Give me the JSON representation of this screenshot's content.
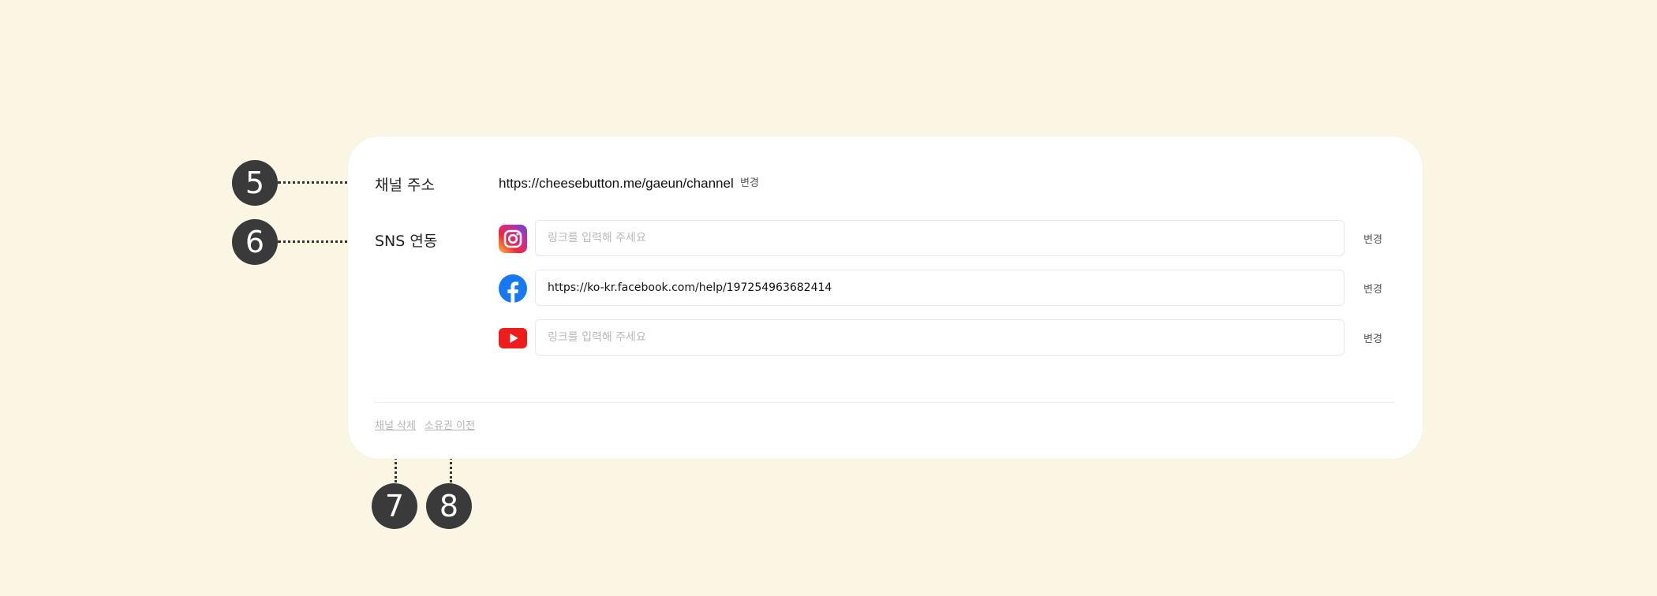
{
  "channel_address": {
    "label": "채널 주소",
    "url": "https://cheesebutton.me/gaeun/channel",
    "change_label": "변경"
  },
  "sns": {
    "label": "SNS 연동",
    "rows": [
      {
        "icon": "instagram-icon",
        "value": "",
        "placeholder": "링크를 입력해 주세요",
        "change_label": "변경"
      },
      {
        "icon": "facebook-icon",
        "value": "https://ko-kr.facebook.com/help/197254963682414",
        "placeholder": "링크를 입력해 주세요",
        "change_label": "변경"
      },
      {
        "icon": "youtube-icon",
        "value": "",
        "placeholder": "링크를 입력해 주세요",
        "change_label": "변경"
      }
    ]
  },
  "footer": {
    "delete_channel": "채널 삭제",
    "transfer_ownership": "소유권 이전"
  },
  "markers": [
    "5",
    "6",
    "7",
    "8"
  ],
  "colors": {
    "background": "#faf6e3",
    "card": "#ffffff",
    "marker": "#3a3a3a",
    "facebook": "#1877f2",
    "youtube": "#ee1d1d"
  }
}
